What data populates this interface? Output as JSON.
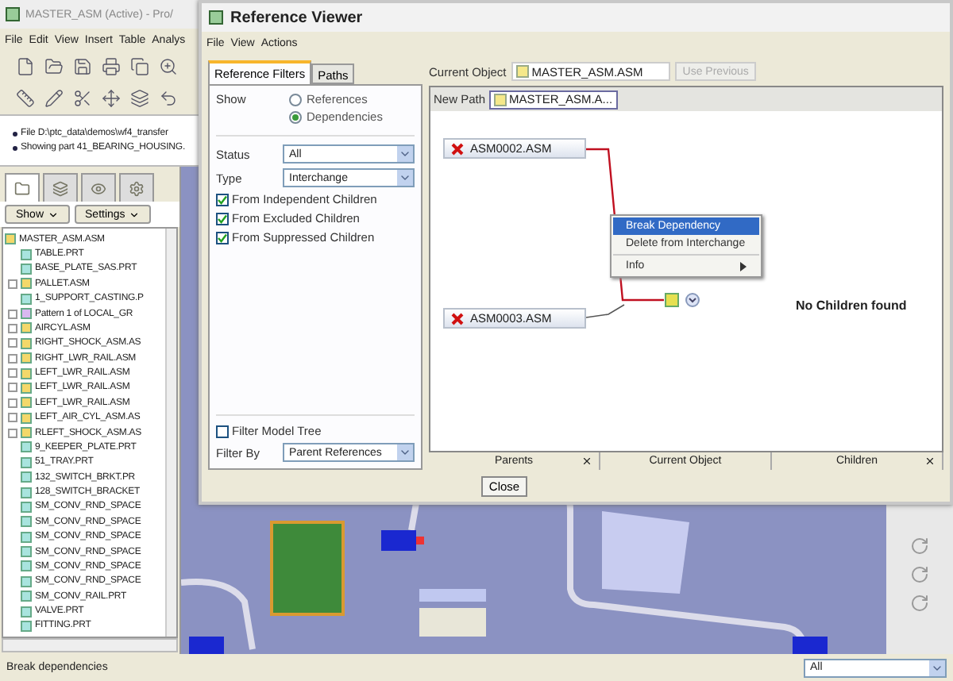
{
  "main_window": {
    "title": "MASTER_ASM (Active) - Pro/",
    "menu": [
      "File",
      "Edit",
      "View",
      "Insert",
      "Table",
      "Analys"
    ],
    "messages": [
      "File D:\\ptc_data\\demos\\wf4_transfer",
      "Showing part 41_BEARING_HOUSING."
    ]
  },
  "navigator": {
    "tabs": [
      {
        "selected": true
      },
      {
        "selected": false
      },
      {
        "selected": false
      },
      {
        "selected": false
      }
    ],
    "buttons": [
      "Show",
      "Settings"
    ],
    "tree": {
      "label": "MASTER_ASM.ASM",
      "kind": "assembly",
      "children": [
        {
          "label": "TABLE.PRT",
          "kind": "part"
        },
        {
          "label": "BASE_PLATE_SAS.PRT",
          "kind": "part"
        },
        {
          "label": "PALLET.ASM",
          "kind": "assembly"
        },
        {
          "label": "1_SUPPORT_CASTING.P",
          "kind": "part"
        },
        {
          "label": "Pattern 1 of LOCAL_GR",
          "kind": "pattern"
        },
        {
          "label": "AIRCYL.ASM",
          "kind": "assembly"
        },
        {
          "label": "RIGHT_SHOCK_ASM.AS",
          "kind": "assembly"
        },
        {
          "label": "RIGHT_LWR_RAIL.ASM",
          "kind": "assembly"
        },
        {
          "label": "LEFT_LWR_RAIL.ASM",
          "kind": "assembly"
        },
        {
          "label": "LEFT_LWR_RAIL.ASM",
          "kind": "assembly"
        },
        {
          "label": "LEFT_LWR_RAIL.ASM",
          "kind": "assembly"
        },
        {
          "label": "LEFT_AIR_CYL_ASM.AS",
          "kind": "assembly"
        },
        {
          "label": "RLEFT_SHOCK_ASM.AS",
          "kind": "assembly"
        },
        {
          "label": "9_KEEPER_PLATE.PRT",
          "kind": "part"
        },
        {
          "label": "51_TRAY.PRT",
          "kind": "part"
        },
        {
          "label": "132_SWITCH_BRKT.PR",
          "kind": "part"
        },
        {
          "label": "128_SWITCH_BRACKET",
          "kind": "part"
        },
        {
          "label": "SM_CONV_RND_SPACE",
          "kind": "part"
        },
        {
          "label": "SM_CONV_RND_SPACE",
          "kind": "part"
        },
        {
          "label": "SM_CONV_RND_SPACE",
          "kind": "part"
        },
        {
          "label": "SM_CONV_RND_SPACE",
          "kind": "part"
        },
        {
          "label": "SM_CONV_RND_SPACE",
          "kind": "part"
        },
        {
          "label": "SM_CONV_RND_SPACE",
          "kind": "part"
        },
        {
          "label": "SM_CONV_RAIL.PRT",
          "kind": "part"
        },
        {
          "label": "VALVE.PRT",
          "kind": "part"
        },
        {
          "label": "FITTING.PRT",
          "kind": "part"
        }
      ]
    }
  },
  "status_bar": {
    "message": "Break dependencies",
    "filter": "All"
  },
  "dialog": {
    "title": "Reference Viewer",
    "menu": [
      "File",
      "View",
      "Actions"
    ],
    "tabs": [
      {
        "label": "Reference Filters",
        "selected": true
      },
      {
        "label": "Paths",
        "selected": false
      }
    ],
    "show_label": "Show",
    "show_options": [
      {
        "label": "References",
        "selected": false
      },
      {
        "label": "Dependencies",
        "selected": true
      }
    ],
    "fields": [
      {
        "label": "Status",
        "value": "All"
      },
      {
        "label": "Type",
        "value": "Interchange"
      }
    ],
    "checkboxes": [
      {
        "label": "From Independent Children",
        "checked": true
      },
      {
        "label": "From Excluded Children",
        "checked": true
      },
      {
        "label": "From Suppressed Children",
        "checked": true
      }
    ],
    "filter_model_tree": {
      "label": "Filter Model Tree",
      "checked": false
    },
    "filter_by": {
      "label": "Filter By",
      "value": "Parent References"
    },
    "current_object": {
      "label": "Current Object",
      "value": "MASTER_ASM.ASM"
    },
    "use_previous": {
      "label": "Use Previous",
      "disabled": true
    },
    "new_path": {
      "label": "New Path",
      "value": "MASTER_ASM.A..."
    },
    "nodes": [
      {
        "label": "ASM0002.ASM"
      },
      {
        "label": "ASM0003.ASM"
      }
    ],
    "context_menu": [
      {
        "label": "Break Dependency",
        "selected": true,
        "submenu": false
      },
      {
        "label": "Delete from Interchange",
        "selected": false,
        "submenu": false
      },
      {
        "label": "Info",
        "selected": false,
        "submenu": true
      }
    ],
    "children_message": "No Children found",
    "panes": [
      {
        "label": "Parents",
        "closable": true
      },
      {
        "label": "Current Object",
        "closable": false
      },
      {
        "label": "Children",
        "closable": true
      }
    ],
    "close_button": "Close"
  }
}
